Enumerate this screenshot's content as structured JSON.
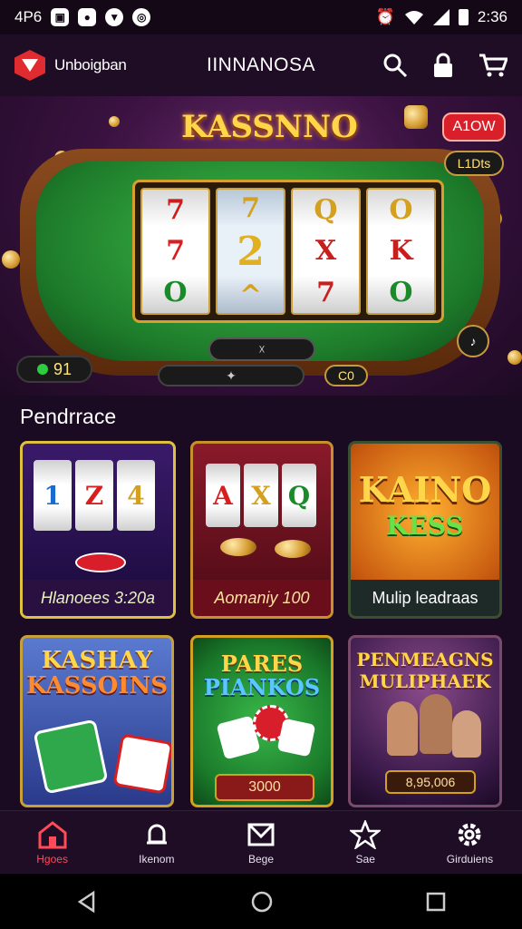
{
  "status": {
    "left_text": "4P6",
    "time": "2:36"
  },
  "app": {
    "brand": "Unboigban",
    "title": "IINNANOSA"
  },
  "hero": {
    "title": "KASSNNO",
    "top_button": "A1OW",
    "side_badge": "L1Dts",
    "reels": [
      [
        "7",
        "7",
        "O"
      ],
      [
        "7",
        "2",
        "^"
      ],
      [
        "Q",
        "X",
        "7"
      ],
      [
        "O",
        "K",
        "O"
      ]
    ],
    "center_badge": "☓",
    "left_counter": "91",
    "right_counter": "C0"
  },
  "section": {
    "title": "Pendrrace"
  },
  "cards": [
    {
      "label": "Hlanoees 3:20a",
      "mini": [
        "1",
        "Z",
        "4"
      ]
    },
    {
      "label": "Aomaniy 100",
      "mini": [
        "A",
        "X",
        "Q"
      ]
    },
    {
      "label": "Mulip leadraas",
      "art_line1": "KAINO",
      "art_line2": "KESS"
    },
    {
      "art_line1": "KASHAY",
      "art_line2": "KASSOINS"
    },
    {
      "art_line1": "PARES",
      "art_line2": "PIANKOS",
      "value": "3000"
    },
    {
      "art_line1": "PENMEAGNS",
      "art_line2": "MULIPHAEK",
      "value": "8,95,006"
    }
  ],
  "nav": [
    {
      "label": "Hgoes",
      "icon": "home-icon"
    },
    {
      "label": "Ikenom",
      "icon": "bell-icon"
    },
    {
      "label": "Bege",
      "icon": "mail-icon"
    },
    {
      "label": "Sae",
      "icon": "star-icon"
    },
    {
      "label": "Girduiens",
      "icon": "gear-icon"
    }
  ],
  "colors": {
    "accent": "#ff4a5a",
    "gold": "#ffd54a",
    "felt": "#1d7a2a"
  }
}
